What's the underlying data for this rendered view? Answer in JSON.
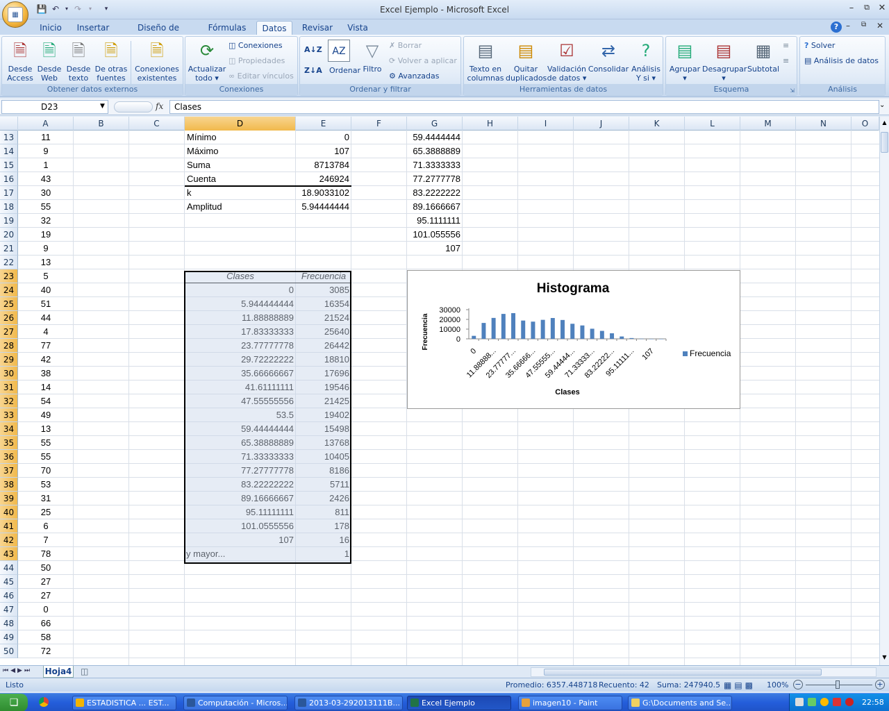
{
  "window": {
    "title": "Excel Ejemplo - Microsoft Excel"
  },
  "ribbon_tabs": [
    "Inicio",
    "Insertar",
    "Diseño de página",
    "Fórmulas",
    "Datos",
    "Revisar",
    "Vista"
  ],
  "active_tab": "Datos",
  "groups": {
    "externos": {
      "label": "Obtener datos externos",
      "b1": "Desde",
      "b1b": "Access",
      "b2": "Desde",
      "b2b": "Web",
      "b3": "Desde",
      "b3b": "texto",
      "b4": "De otras",
      "b4b": "fuentes",
      "b5": "Conexiones",
      "b5b": "existentes"
    },
    "conexiones": {
      "label": "Conexiones",
      "actualizar": "Actualizar",
      "actualizar_b": "todo",
      "conexiones": "Conexiones",
      "propiedades": "Propiedades",
      "editar": "Editar vínculos"
    },
    "ordenar": {
      "label": "Ordenar y filtrar",
      "ordenar": "Ordenar",
      "filtro": "Filtro",
      "borrar": "Borrar",
      "volver": "Volver a aplicar",
      "avanzadas": "Avanzadas"
    },
    "herramientas": {
      "label": "Herramientas de datos",
      "texto": "Texto en",
      "texto_b": "columnas",
      "quitar": "Quitar",
      "quitar_b": "duplicados",
      "validacion": "Validación",
      "validacion_b": "de datos",
      "consolidar": "Consolidar",
      "analisis": "Análisis",
      "analisis_b": "Y si"
    },
    "esquema": {
      "label": "Esquema",
      "agrupar": "Agrupar",
      "desagrupar": "Desagrupar",
      "subtotal": "Subtotal"
    },
    "analisis": {
      "label": "Análisis",
      "solver": "Solver",
      "datos": "Análisis de datos"
    }
  },
  "formula_bar": {
    "name_box": "D23",
    "fx": "fx",
    "value": "Clases"
  },
  "columns": [
    "A",
    "B",
    "C",
    "D",
    "E",
    "F",
    "G",
    "H",
    "I",
    "J",
    "K",
    "L",
    "M",
    "N",
    "O"
  ],
  "selected_column": "D",
  "rows": [
    "13",
    "14",
    "15",
    "16",
    "17",
    "18",
    "19",
    "20",
    "21",
    "22",
    "23",
    "24",
    "25",
    "26",
    "27",
    "28",
    "29",
    "30",
    "31",
    "32",
    "33",
    "34",
    "35",
    "36",
    "37",
    "38",
    "39",
    "40",
    "41",
    "42",
    "43",
    "44",
    "45",
    "46",
    "47",
    "48",
    "49",
    "50"
  ],
  "col_a": [
    "11",
    "9",
    "1",
    "43",
    "30",
    "55",
    "32",
    "19",
    "9",
    "13",
    "5",
    "40",
    "51",
    "44",
    "4",
    "77",
    "42",
    "38",
    "14",
    "54",
    "49",
    "13",
    "55",
    "55",
    "70",
    "53",
    "31",
    "25",
    "6",
    "7",
    "78",
    "50",
    "27",
    "27",
    "0",
    "66",
    "58",
    "72"
  ],
  "stats": [
    {
      "label": "Mínimo",
      "value": "0"
    },
    {
      "label": "Máximo",
      "value": "107"
    },
    {
      "label": "Suma",
      "value": "8713784"
    },
    {
      "label": "Cuenta",
      "value": "246924"
    },
    {
      "label": "k",
      "value": "18.9033102"
    },
    {
      "label": "Amplitud",
      "value": "5.94444444"
    }
  ],
  "col_g": [
    "59.4444444",
    "65.3888889",
    "71.3333333",
    "77.2777778",
    "83.2222222",
    "89.1666667",
    "95.1111111",
    "101.055556",
    "107"
  ],
  "table": {
    "header_clases": "Clases",
    "header_frecuencia": "Frecuencia",
    "clases": [
      "0",
      "5.944444444",
      "11.88888889",
      "17.83333333",
      "23.77777778",
      "29.72222222",
      "35.66666667",
      "41.61111111",
      "47.55555556",
      "53.5",
      "59.44444444",
      "65.38888889",
      "71.33333333",
      "77.27777778",
      "83.22222222",
      "89.16666667",
      "95.11111111",
      "101.0555556",
      "107",
      "y mayor..."
    ],
    "frecuencias": [
      "3085",
      "16354",
      "21524",
      "25640",
      "26442",
      "18810",
      "17696",
      "19546",
      "21425",
      "19402",
      "15498",
      "13768",
      "10405",
      "8186",
      "5711",
      "2426",
      "811",
      "178",
      "16",
      "1"
    ]
  },
  "chart_data": {
    "type": "bar",
    "title": "Histograma",
    "xlabel": "Clases",
    "ylabel": "Frecuencia",
    "ylim": [
      0,
      30000
    ],
    "yticks": [
      "30000",
      "20000",
      "10000",
      "0"
    ],
    "xticklabels": [
      "0",
      "11.88888...",
      "23.77777...",
      "35.66666...",
      "47.55555...",
      "59.44444...",
      "71.33333...",
      "83.22222...",
      "95.11111...",
      "107"
    ],
    "categories": [
      "0",
      "5.944444444",
      "11.88888889",
      "17.83333333",
      "23.77777778",
      "29.72222222",
      "35.66666667",
      "41.61111111",
      "47.55555556",
      "53.5",
      "59.44444444",
      "65.38888889",
      "71.33333333",
      "77.27777778",
      "83.22222222",
      "89.16666667",
      "95.11111111",
      "101.0555556",
      "107",
      "y mayor..."
    ],
    "series": [
      {
        "name": "Frecuencia",
        "values": [
          3085,
          16354,
          21524,
          25640,
          26442,
          18810,
          17696,
          19546,
          21425,
          19402,
          15498,
          13768,
          10405,
          8186,
          5711,
          2426,
          811,
          178,
          16,
          1
        ]
      }
    ],
    "legend": "right",
    "color": "#4f81bd"
  },
  "sheet_tab": "Hoja4",
  "status": {
    "left": "Listo",
    "promedio": "Promedio: 6357.448718",
    "recuento": "Recuento: 42",
    "suma": "Suma: 247940.5",
    "zoom": "100%"
  },
  "taskbar": {
    "items": [
      "ESTADISTICA ... EST...",
      "Computación - Micros...",
      "2013-03-292013111B...",
      "Excel Ejemplo",
      "imagen10 - Paint",
      "G:\\Documents and Se..."
    ],
    "clock": "22:58"
  }
}
